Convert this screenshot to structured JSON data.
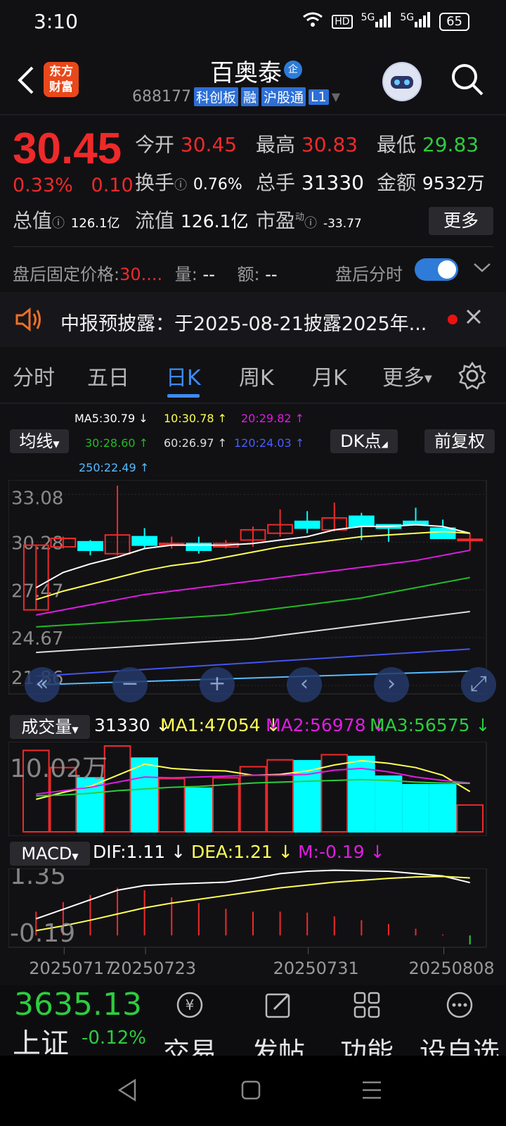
{
  "status_bar": {
    "time": "3:10",
    "battery": "65",
    "network1": "5G",
    "network2": "5G",
    "hd": "HD"
  },
  "header": {
    "logo_line1": "东方",
    "logo_line2": "财富",
    "title": "百奥泰",
    "verified_badge": "企",
    "code": "688177",
    "tags": [
      "科创板",
      "融",
      "沪股通",
      "L1"
    ]
  },
  "quote": {
    "price": "30.45",
    "change_pct": "0.33%",
    "change_amt": "0.10",
    "open_label": "今开",
    "open": "30.45",
    "high_label": "最高",
    "high": "30.83",
    "low_label": "最低",
    "low": "29.83",
    "turnover_label": "换手",
    "turnover": "0.76%",
    "volume_label": "总手",
    "volume": "31330",
    "amount_label": "金额",
    "amount": "9532万",
    "mktcap_label": "总值",
    "mktcap": "126.1亿",
    "float_label": "流值",
    "float_cap": "126.1亿",
    "pe_label": "市盈",
    "pe_sup": "动",
    "pe": "-33.77",
    "more_button": "更多"
  },
  "after_hours": {
    "label": "盘后固定价格:",
    "price": "30....",
    "vol_label": "量:",
    "vol": "--",
    "amt_label": "额:",
    "amt": "--",
    "toggle_label": "盘后分时",
    "toggle_on": true
  },
  "notice": {
    "text": "中报预披露：于2025-08-21披露2025年..."
  },
  "tabs": [
    {
      "label": "分时",
      "active": false
    },
    {
      "label": "五日",
      "active": false
    },
    {
      "label": "日K",
      "active": true
    },
    {
      "label": "周K",
      "active": false
    },
    {
      "label": "月K",
      "active": false
    },
    {
      "label": "更多",
      "active": false
    }
  ],
  "ma_legend": {
    "ma5": "MA5:30.79 ↓",
    "ma10": "10:30.78 ↑",
    "ma20": "20:29.82 ↑",
    "ma30": "30:28.60 ↑",
    "ma60": "60:26.97 ↑",
    "ma120": "120:24.03 ↑",
    "ma250": "250:22.49 ↑",
    "junxian": "均线",
    "dk": "DK点",
    "fuquan": "前复权"
  },
  "volume_legend": {
    "label": "成交量",
    "vol": "31330 ↓",
    "ma1": "MA1:47054 ↓",
    "ma2": "MA2:56978 ↓",
    "ma3": "MA3:56575 ↓",
    "axis_top": "10.02万"
  },
  "macd_legend": {
    "label": "MACD",
    "dif": "DIF:1.11 ↓",
    "dea": "DEA:1.21 ↓",
    "m": "M:-0.19 ↓",
    "axis_top": "1.35",
    "axis_bottom": "-0.19"
  },
  "date_axis": [
    "20250717",
    "20250723",
    "20250731",
    "20250808"
  ],
  "bottom_bar": {
    "index_value": "3635.13",
    "index_name": "上证",
    "index_change": "-0.12%",
    "items": [
      "交易",
      "发帖",
      "功能",
      "设自选"
    ]
  },
  "colors": {
    "up": "#ee2a2a",
    "down": "#00ffff",
    "accent": "#3d8bf2",
    "green": "#2ccd3e"
  },
  "chart_data": {
    "type": "candlestick",
    "y_ticks": [
      "33.08",
      "30.28",
      "27.47",
      "24.67",
      "21.86"
    ],
    "ylim": [
      21.86,
      33.6
    ],
    "candles": [
      {
        "o": 26.3,
        "c": 30.1,
        "h": 30.1,
        "l": 26.3,
        "dir": "up"
      },
      {
        "o": 30.0,
        "c": 30.5,
        "h": 30.6,
        "l": 29.9,
        "dir": "up"
      },
      {
        "o": 30.3,
        "c": 29.8,
        "h": 30.4,
        "l": 29.5,
        "dir": "down"
      },
      {
        "o": 29.6,
        "c": 30.7,
        "h": 33.6,
        "l": 29.5,
        "dir": "up"
      },
      {
        "o": 30.6,
        "c": 30.1,
        "h": 31.1,
        "l": 29.9,
        "dir": "down"
      },
      {
        "o": 30.2,
        "c": 30.2,
        "h": 30.6,
        "l": 29.9,
        "dir": "up"
      },
      {
        "o": 30.2,
        "c": 29.8,
        "h": 30.6,
        "l": 29.6,
        "dir": "down"
      },
      {
        "o": 30.0,
        "c": 30.2,
        "h": 30.4,
        "l": 29.9,
        "dir": "up"
      },
      {
        "o": 30.4,
        "c": 31.0,
        "h": 31.2,
        "l": 30.0,
        "dir": "up"
      },
      {
        "o": 30.8,
        "c": 31.3,
        "h": 32.2,
        "l": 30.6,
        "dir": "up"
      },
      {
        "o": 31.5,
        "c": 31.1,
        "h": 32.1,
        "l": 30.8,
        "dir": "down"
      },
      {
        "o": 31.0,
        "c": 31.7,
        "h": 32.6,
        "l": 30.9,
        "dir": "up"
      },
      {
        "o": 31.8,
        "c": 31.2,
        "h": 32.0,
        "l": 30.4,
        "dir": "down"
      },
      {
        "o": 31.3,
        "c": 31.1,
        "h": 31.3,
        "l": 30.3,
        "dir": "down"
      },
      {
        "o": 31.5,
        "c": 31.3,
        "h": 32.3,
        "l": 31.3,
        "dir": "down"
      },
      {
        "o": 31.1,
        "c": 30.5,
        "h": 31.6,
        "l": 30.5,
        "dir": "down"
      },
      {
        "o": 30.4,
        "c": 30.45,
        "h": 30.8,
        "l": 29.8,
        "dir": "up"
      }
    ],
    "ma_lines": [
      {
        "name": "MA5",
        "color": "#ffffff",
        "values": [
          27.6,
          28.5,
          29.0,
          29.4,
          29.9,
          30.1,
          30.1,
          30.1,
          30.2,
          30.4,
          30.6,
          31.0,
          31.2,
          31.2,
          31.3,
          31.2,
          30.8
        ]
      },
      {
        "name": "MA10",
        "color": "#ffff55",
        "values": [
          26.9,
          27.4,
          27.8,
          28.2,
          28.6,
          28.9,
          29.1,
          29.4,
          29.7,
          30.0,
          30.2,
          30.4,
          30.6,
          30.7,
          30.8,
          30.9,
          30.8
        ]
      },
      {
        "name": "MA20",
        "color": "#e01ce0",
        "values": [
          26.0,
          26.3,
          26.6,
          26.9,
          27.2,
          27.4,
          27.6,
          27.8,
          28.0,
          28.2,
          28.4,
          28.6,
          28.8,
          29.0,
          29.2,
          29.5,
          29.8
        ]
      },
      {
        "name": "MA30",
        "color": "#22bb22",
        "values": [
          25.3,
          25.4,
          25.5,
          25.6,
          25.7,
          25.8,
          25.9,
          26.0,
          26.2,
          26.4,
          26.6,
          26.8,
          27.0,
          27.3,
          27.6,
          27.9,
          28.2
        ]
      },
      {
        "name": "MA60",
        "color": "#dddddd",
        "values": [
          23.8,
          23.9,
          24.0,
          24.1,
          24.2,
          24.3,
          24.4,
          24.5,
          24.6,
          24.8,
          25.0,
          25.2,
          25.4,
          25.6,
          25.8,
          26.0,
          26.2
        ]
      },
      {
        "name": "MA120",
        "color": "#4455ee",
        "values": [
          22.4,
          22.5,
          22.6,
          22.7,
          22.8,
          22.9,
          23.0,
          23.1,
          23.2,
          23.3,
          23.4,
          23.5,
          23.6,
          23.7,
          23.8,
          23.9,
          24.0
        ]
      },
      {
        "name": "MA250",
        "color": "#55bbff",
        "values": [
          21.9,
          21.95,
          22.0,
          22.05,
          22.1,
          22.15,
          22.2,
          22.25,
          22.3,
          22.35,
          22.4,
          22.45,
          22.5,
          22.55,
          22.6,
          22.65,
          22.7
        ]
      }
    ],
    "volume": {
      "ymax": 100200,
      "values": [
        95000,
        75000,
        63000,
        100200,
        86000,
        62000,
        51000,
        63000,
        76000,
        84000,
        83000,
        90000,
        88000,
        65000,
        55000,
        55000,
        31330
      ],
      "ma1": [
        38000,
        46000,
        53000,
        66000,
        79000,
        74000,
        72000,
        71000,
        66000,
        67000,
        71000,
        78000,
        83000,
        80000,
        75000,
        66000,
        47054
      ],
      "ma2": [
        44000,
        48000,
        52000,
        58000,
        64000,
        63000,
        64000,
        65000,
        66000,
        66000,
        67000,
        72000,
        74000,
        70000,
        64000,
        60000,
        56978
      ],
      "ma3": [
        42000,
        43000,
        45000,
        48000,
        50000,
        52000,
        53000,
        55000,
        57000,
        58000,
        59000,
        60000,
        61000,
        60000,
        58000,
        57000,
        56575
      ]
    },
    "macd": {
      "ymin": -0.19,
      "ymax": 1.35,
      "dif": [
        0.35,
        0.55,
        0.75,
        0.95,
        1.05,
        1.08,
        1.1,
        1.12,
        1.2,
        1.3,
        1.35,
        1.37,
        1.36,
        1.35,
        1.3,
        1.25,
        1.11
      ],
      "dea": [
        0.1,
        0.2,
        0.32,
        0.45,
        0.58,
        0.68,
        0.76,
        0.84,
        0.92,
        1.0,
        1.06,
        1.12,
        1.16,
        1.2,
        1.23,
        1.24,
        1.21
      ],
      "m": [
        0.5,
        0.7,
        0.85,
        1.0,
        0.95,
        0.8,
        0.68,
        0.56,
        0.5,
        0.5,
        0.48,
        0.4,
        0.32,
        0.24,
        0.14,
        0.02,
        -0.19
      ]
    }
  }
}
